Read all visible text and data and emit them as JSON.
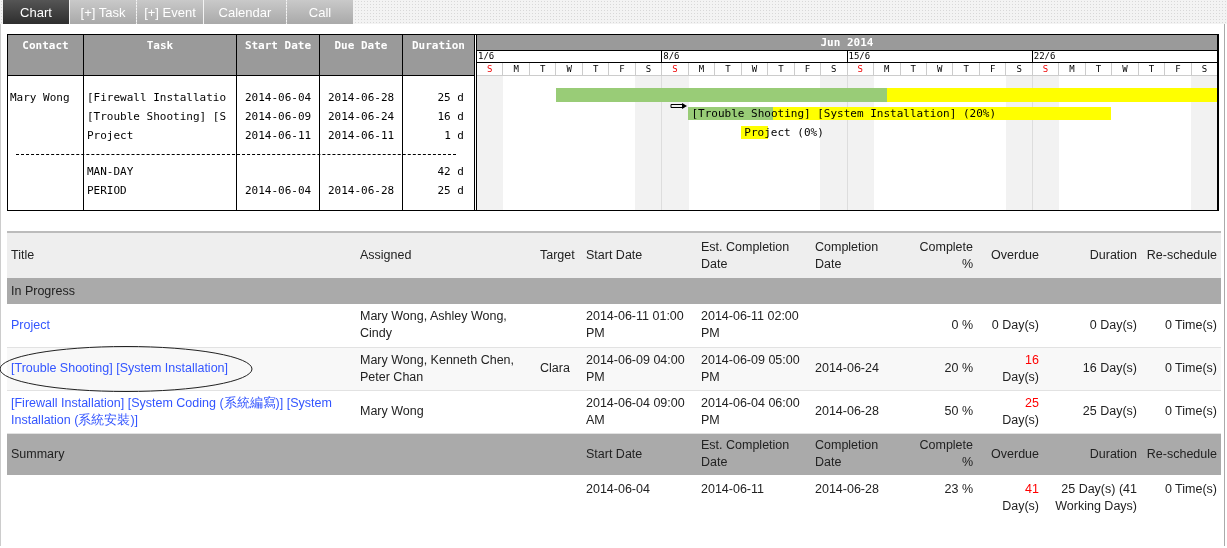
{
  "tabs": [
    {
      "label": "Chart",
      "selected": true
    },
    {
      "label": "[+] Task",
      "selected": false
    },
    {
      "label": "[+] Event",
      "selected": false
    },
    {
      "label": "Calendar",
      "selected": false
    },
    {
      "label": "Call",
      "selected": false
    }
  ],
  "gantt": {
    "columns": [
      "Contact",
      "Task",
      "Start Date",
      "Due Date",
      "Duration"
    ],
    "contact": "Mary Wong",
    "tasks": [
      {
        "task": "[Firewall Installatio",
        "start": "2014-06-04",
        "due": "2014-06-28",
        "duration": "25 d",
        "level": 0.5,
        "depends": false
      },
      {
        "task": "[Trouble Shooting] [S",
        "start": "2014-06-09",
        "due": "2014-06-24",
        "duration": "16 d",
        "level": 0.2,
        "depends": true,
        "bar_label": "[Trouble Shooting] [System Installation] (20%)"
      },
      {
        "task": "Project",
        "start": "2014-06-11",
        "due": "2014-06-11",
        "duration": "1 d",
        "level": 0,
        "depends": false,
        "bar_label": "Project (0%)"
      }
    ],
    "totals": [
      {
        "label": "MAN-DAY",
        "duration": "42 d"
      },
      {
        "label": "PERIOD",
        "start": "2014-06-04",
        "due": "2014-06-28",
        "duration": "25 d"
      }
    ],
    "month": "Jun 2014",
    "weeks": [
      "1/6",
      "8/6",
      "15/6",
      "22/6"
    ],
    "days": [
      {
        "letter": "S",
        "kind": "sunday"
      },
      {
        "letter": "M",
        "kind": "weekday"
      },
      {
        "letter": "T",
        "kind": "weekday"
      },
      {
        "letter": "W",
        "kind": "weekday"
      },
      {
        "letter": "T",
        "kind": "weekday"
      },
      {
        "letter": "F",
        "kind": "weekday"
      },
      {
        "letter": "S",
        "kind": "saturday"
      },
      {
        "letter": "S",
        "kind": "sunday"
      },
      {
        "letter": "M",
        "kind": "weekday"
      },
      {
        "letter": "T",
        "kind": "weekday"
      },
      {
        "letter": "W",
        "kind": "weekday"
      },
      {
        "letter": "T",
        "kind": "weekday"
      },
      {
        "letter": "F",
        "kind": "weekday"
      },
      {
        "letter": "S",
        "kind": "saturday"
      },
      {
        "letter": "S",
        "kind": "sunday"
      },
      {
        "letter": "M",
        "kind": "weekday"
      },
      {
        "letter": "T",
        "kind": "weekday"
      },
      {
        "letter": "W",
        "kind": "weekday"
      },
      {
        "letter": "T",
        "kind": "weekday"
      },
      {
        "letter": "F",
        "kind": "weekday"
      },
      {
        "letter": "S",
        "kind": "saturday"
      },
      {
        "letter": "S",
        "kind": "sunday"
      },
      {
        "letter": "M",
        "kind": "weekday"
      },
      {
        "letter": "T",
        "kind": "weekday"
      },
      {
        "letter": "W",
        "kind": "weekday"
      },
      {
        "letter": "T",
        "kind": "weekday"
      },
      {
        "letter": "F",
        "kind": "weekday"
      },
      {
        "letter": "S",
        "kind": "saturday"
      }
    ]
  },
  "table": {
    "columns": [
      "Title",
      "Assigned",
      "Target",
      "Start Date",
      "Est. Completion Date",
      "Completion Date",
      "Complete %",
      "Overdue",
      "Duration",
      "Re-schedule"
    ],
    "group": "In Progress",
    "rows": [
      {
        "title": "Project",
        "assigned": "Mary Wong, Ashley Wong, Cindy",
        "start": "2014-06-11 01:00 PM",
        "est": "2014-06-11 02:00 PM",
        "complete": "0 %",
        "overdue": {
          "count": "0",
          "unit": "Day(s)",
          "late": false
        },
        "duration": "0 Day(s)",
        "reschedule": "0 Time(s)",
        "circled": false
      },
      {
        "title": "[Trouble Shooting] [System Installation]",
        "assigned": "Mary Wong, Kenneth Chen, Peter Chan",
        "target": "Clara",
        "start": "2014-06-09 04:00 PM",
        "est": "2014-06-09 05:00 PM",
        "completion": "2014-06-24",
        "complete": "20 %",
        "overdue": {
          "count": "16",
          "unit": "Day(s)",
          "late": true
        },
        "duration": "16 Day(s)",
        "reschedule": "0 Time(s)",
        "circled": true
      },
      {
        "title": "[Firewall Installation] [System Coding (系統編寫)] [System Installation (系統安裝)]",
        "assigned": "Mary Wong",
        "start": "2014-06-04 09:00 AM",
        "est": "2014-06-04 06:00 PM",
        "completion": "2014-06-28",
        "complete": "50 %",
        "overdue": {
          "count": "25",
          "unit": "Day(s)",
          "late": true
        },
        "duration": "25 Day(s)",
        "reschedule": "0 Time(s)",
        "circled": false
      }
    ],
    "summary": {
      "label": "Summary",
      "columns": [
        "Start Date",
        "Est. Completion Date",
        "Completion Date",
        "Complete %",
        "Overdue",
        "Duration",
        "Re-schedule"
      ],
      "start": "2014-06-04",
      "est": "2014-06-11",
      "completion": "2014-06-28",
      "complete": "23 %",
      "overdue": {
        "count": "41",
        "unit": "Day(s)",
        "late": true
      },
      "duration": "25 Day(s) (41 Working Days)",
      "reschedule": "0 Time(s)"
    }
  }
}
